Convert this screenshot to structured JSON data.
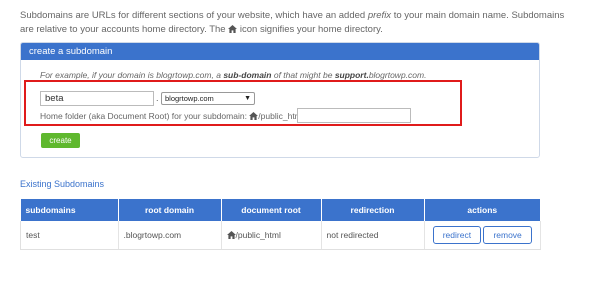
{
  "intro": {
    "text_a": "Subdomains are URLs for different sections of your website, which have an added ",
    "text_em": "prefix",
    "text_b": " to your main domain name. Subdomains are relative to your accounts home directory. The ",
    "text_c": " icon signifies your home directory."
  },
  "create_panel": {
    "title": "create a subdomain",
    "example_a": "For example, if your domain is blogrtowp.com, a ",
    "example_b1": "sub-domain",
    "example_c": " of that might be ",
    "example_b2": "support.",
    "example_d": "blogrtowp.com.",
    "subdomain_value": "beta",
    "dot": ".",
    "domain_selected": "blogrtowp.com",
    "home_folder_label": "Home folder (aka Document Root) for your subdomain: ",
    "home_folder_prefix": "/public_html/",
    "home_folder_value": "",
    "create_label": "create"
  },
  "existing": {
    "title": "Existing Subdomains",
    "columns": [
      "subdomains",
      "root domain",
      "document root",
      "redirection",
      "actions"
    ],
    "rows": [
      {
        "subdomain": "test",
        "root_domain": ".blogrtowp.com",
        "document_root": "/public_html",
        "redirection": "not redirected",
        "redirect_label": "redirect",
        "remove_label": "remove"
      }
    ]
  },
  "colors": {
    "accent": "#3b73cc",
    "create_green": "#5fb82e",
    "highlight_red": "#e01b1b"
  },
  "icons": {
    "home": "home-icon",
    "dropdown": "chevron-down-icon"
  }
}
